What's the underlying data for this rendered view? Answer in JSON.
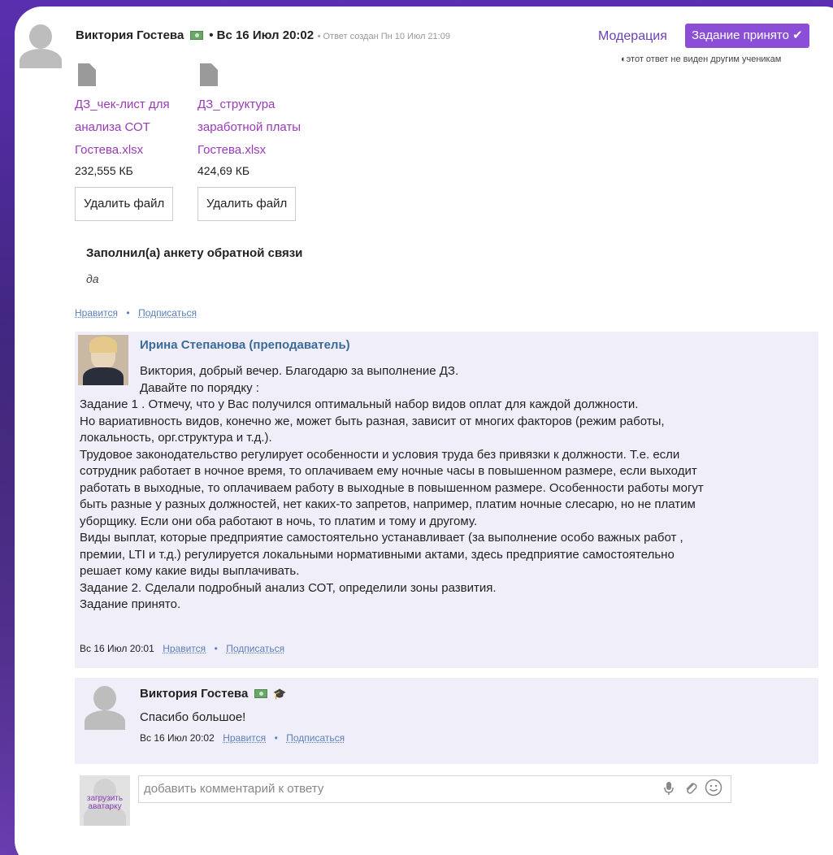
{
  "answer": {
    "author": "Виктория Гостева",
    "date_main": "• Вс 16 Июл 20:02",
    "created_note": "• Ответ создан Пн 10 Июл 21:09",
    "moderation_label": "Модерация",
    "accepted_label": "Задание принято",
    "accepted_icon": "check-icon",
    "hidden_note": "этот ответ не виден другим ученикам",
    "files": [
      {
        "name_lines": [
          "ДЗ_чек-лист для",
          "анализа СОТ",
          "Гостева.xlsx"
        ],
        "size": "232,555 КБ",
        "delete_label": "Удалить файл"
      },
      {
        "name_lines": [
          "ДЗ_структура",
          "заработной платы",
          "Гостева.xlsx"
        ],
        "size": "424,69 КБ",
        "delete_label": "Удалить файл"
      }
    ],
    "feedback_question": "Заполнил(а) анкету обратной связи",
    "feedback_answer": "да",
    "like_label": "Нравится",
    "subscribe_label": "Подписаться",
    "sep": "•"
  },
  "teacher_comment": {
    "author": "Ирина Степанова (преподаватель)",
    "lines": [
      "Виктория, добрый вечер. Благодарю за выполнение ДЗ.",
      "Давайте по порядку :",
      "Задание 1 . Отмечу, что у Вас получился оптимальный набор видов оплат для каждой должности.",
      "Но вариативность видов, конечно же, может быть разная, зависит от многих факторов (режим работы,",
      "локальность, орг.структура и т.д.).",
      "Трудовое законодательство регулирует особенности и условия труда без привязки к должности. Т.е. если",
      "сотрудник работает в ночное время, то оплачиваем ему ночные часы в повышенном размере, если выходит",
      "работать в выходные, то оплачиваем работу в выходные в повышенном размере. Особенности работы могут",
      "быть разные у разных должностей, нет каких-то запретов, например, платим ночные слесарю, но не платим",
      "уборщику. Если они оба работают в ночь, то платим и тому и другому.",
      "Виды выплат, которые предприятие самостоятельно устанавливает (за выполнение особо важных работ ,",
      "премии, LTI и т.д.) регулируется локальными нормативными актами, здесь предприятие самостоятельно",
      "решает кому какие виды выплачивать.",
      "Задание 2. Сделали подробный анализ СОТ, определили зоны развития.",
      "Задание принято."
    ],
    "date": "Вс 16 Июл 20:01",
    "like_label": "Нравится",
    "subscribe_label": "Подписаться",
    "sep": "•"
  },
  "student_reply": {
    "author": "Виктория Гостева",
    "text": "Спасибо большое!",
    "date": "Вс 16 Июл 20:02",
    "like_label": "Нравится",
    "subscribe_label": "Подписаться",
    "sep": "•"
  },
  "comment_input": {
    "placeholder": "добавить комментарий к ответу",
    "upload_avatar_lines": [
      "загрузить",
      "аватарку"
    ]
  },
  "colors": {
    "accent": "#8a4fd6",
    "link_purple": "#9a3ab8",
    "teacher_name": "#3a6b98",
    "comment_bg": "#f0eff9"
  }
}
